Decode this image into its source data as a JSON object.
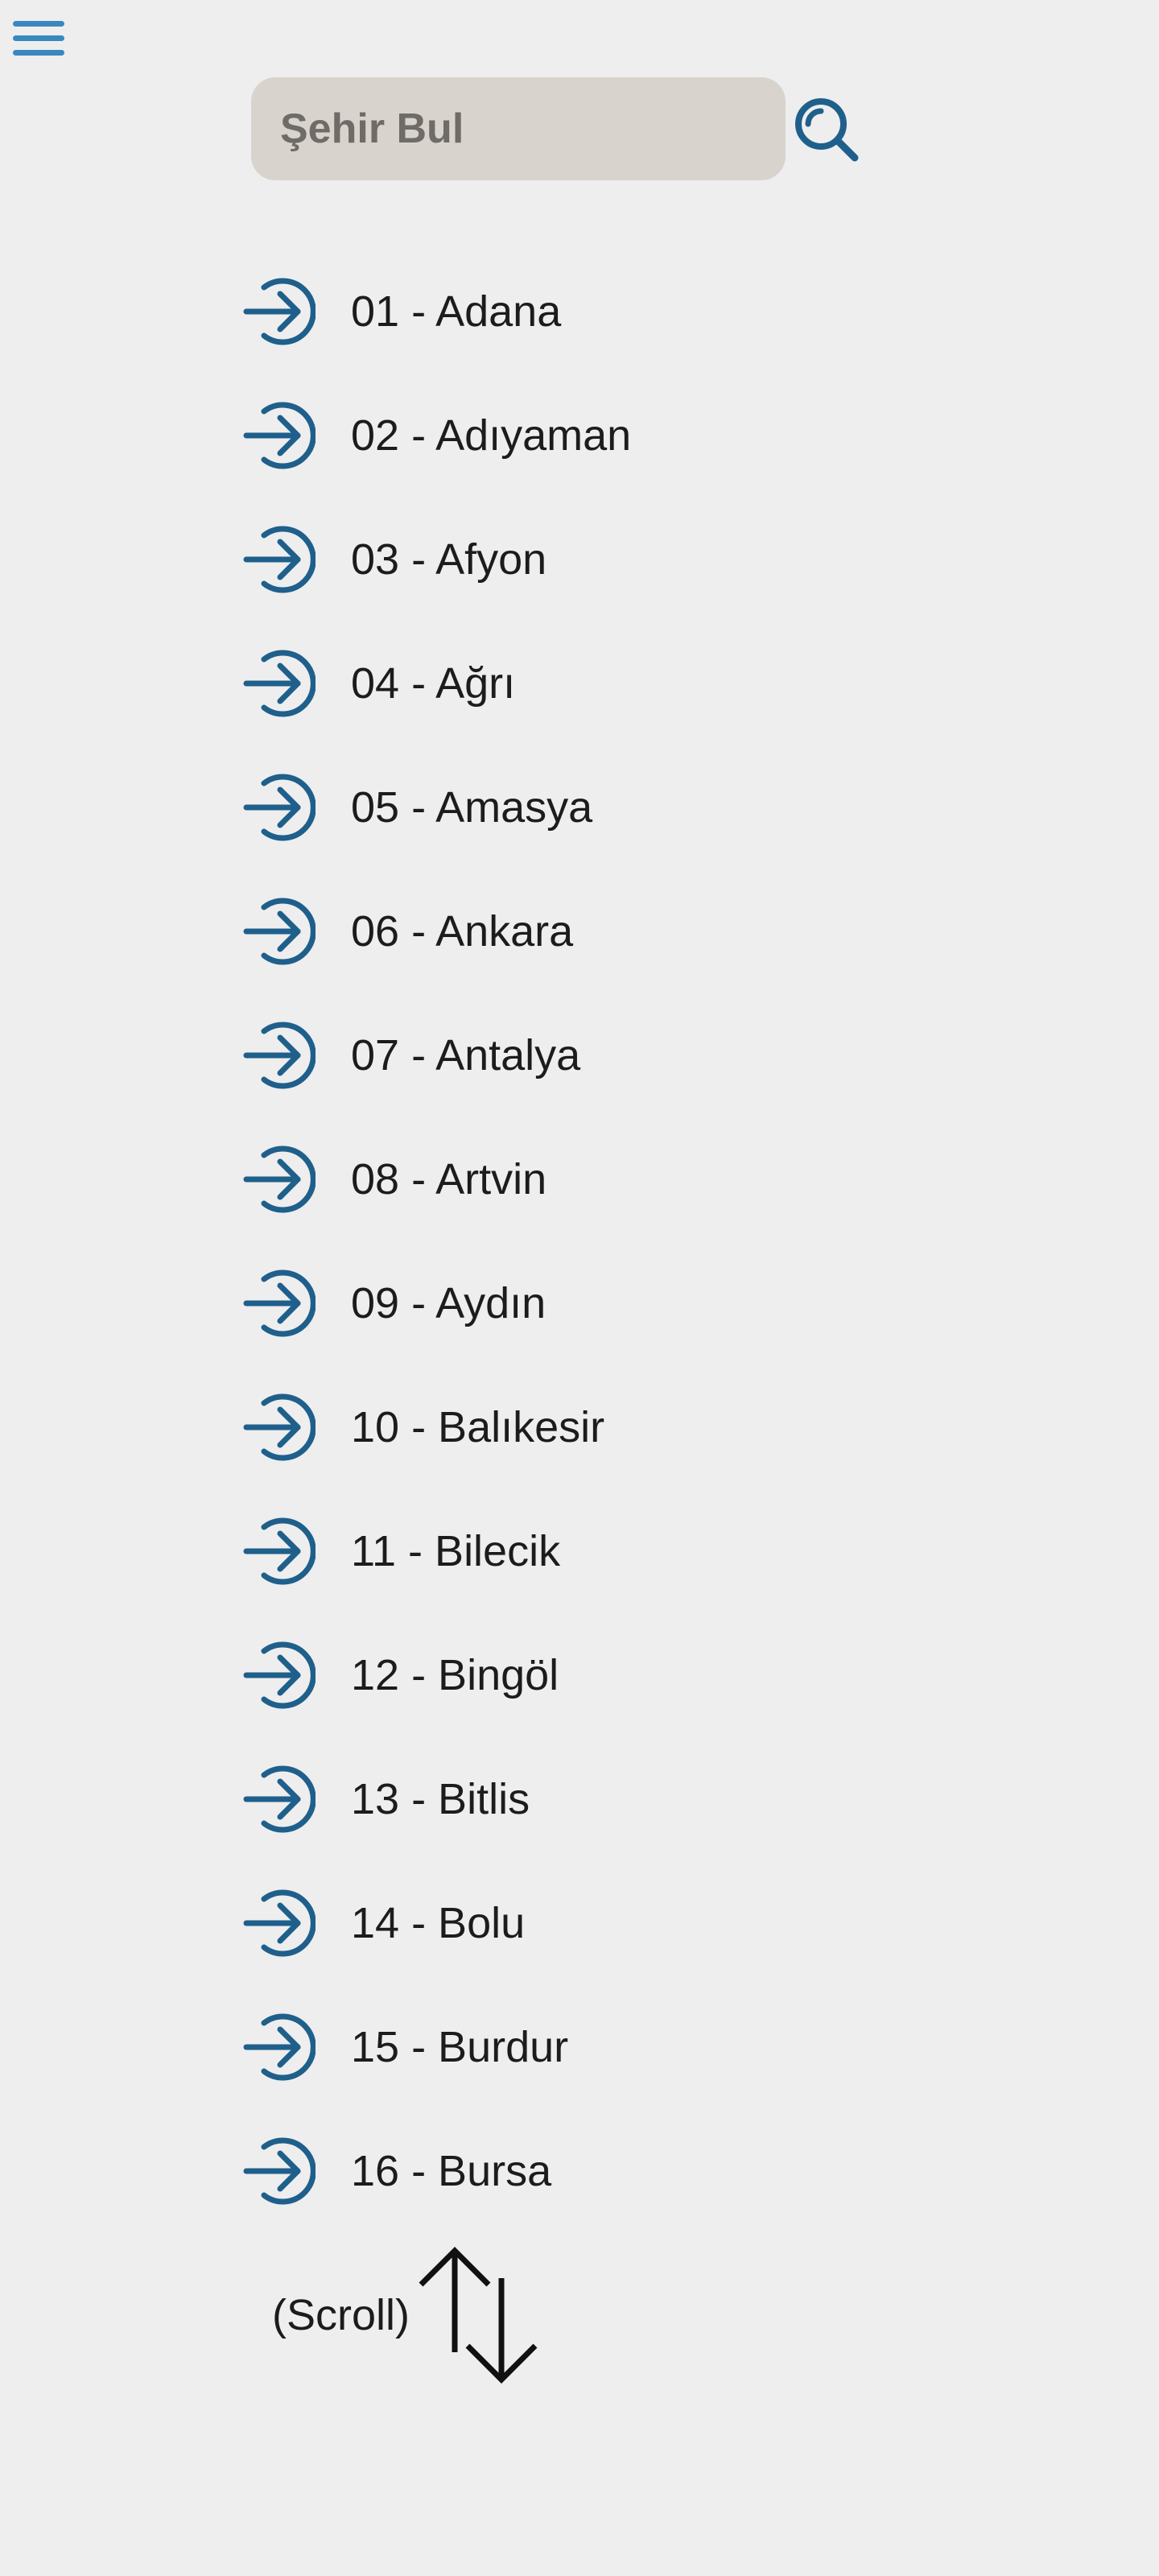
{
  "colors": {
    "background": "#eeeeee",
    "search_field_bg": "#d8d3cd",
    "accent": "#1f5f8b",
    "menu_icon": "#3a88c0",
    "text": "#1c1c1c"
  },
  "header": {
    "menu_icon": "hamburger-menu-icon"
  },
  "search": {
    "placeholder": "Şehir Bul",
    "value": "",
    "button_icon": "magnifier-icon"
  },
  "cities": [
    {
      "label": "01 - Adana",
      "icon": "arrow-right-circle-icon"
    },
    {
      "label": "02 - Adıyaman",
      "icon": "arrow-right-circle-icon"
    },
    {
      "label": "03 - Afyon",
      "icon": "arrow-right-circle-icon"
    },
    {
      "label": "04 - Ağrı",
      "icon": "arrow-right-circle-icon"
    },
    {
      "label": "05 - Amasya",
      "icon": "arrow-right-circle-icon"
    },
    {
      "label": "06 - Ankara",
      "icon": "arrow-right-circle-icon"
    },
    {
      "label": "07 - Antalya",
      "icon": "arrow-right-circle-icon"
    },
    {
      "label": "08 - Artvin",
      "icon": "arrow-right-circle-icon"
    },
    {
      "label": "09 - Aydın",
      "icon": "arrow-right-circle-icon"
    },
    {
      "label": "10 - Balıkesir",
      "icon": "arrow-right-circle-icon"
    },
    {
      "label": "11 - Bilecik",
      "icon": "arrow-right-circle-icon"
    },
    {
      "label": "12 - Bingöl",
      "icon": "arrow-right-circle-icon"
    },
    {
      "label": "13 - Bitlis",
      "icon": "arrow-right-circle-icon"
    },
    {
      "label": "14 - Bolu",
      "icon": "arrow-right-circle-icon"
    },
    {
      "label": "15 - Burdur",
      "icon": "arrow-right-circle-icon"
    },
    {
      "label": "16 - Bursa",
      "icon": "arrow-right-circle-icon"
    }
  ],
  "scroll_hint": {
    "text": "(Scroll)",
    "icon": "up-down-arrows-icon"
  }
}
